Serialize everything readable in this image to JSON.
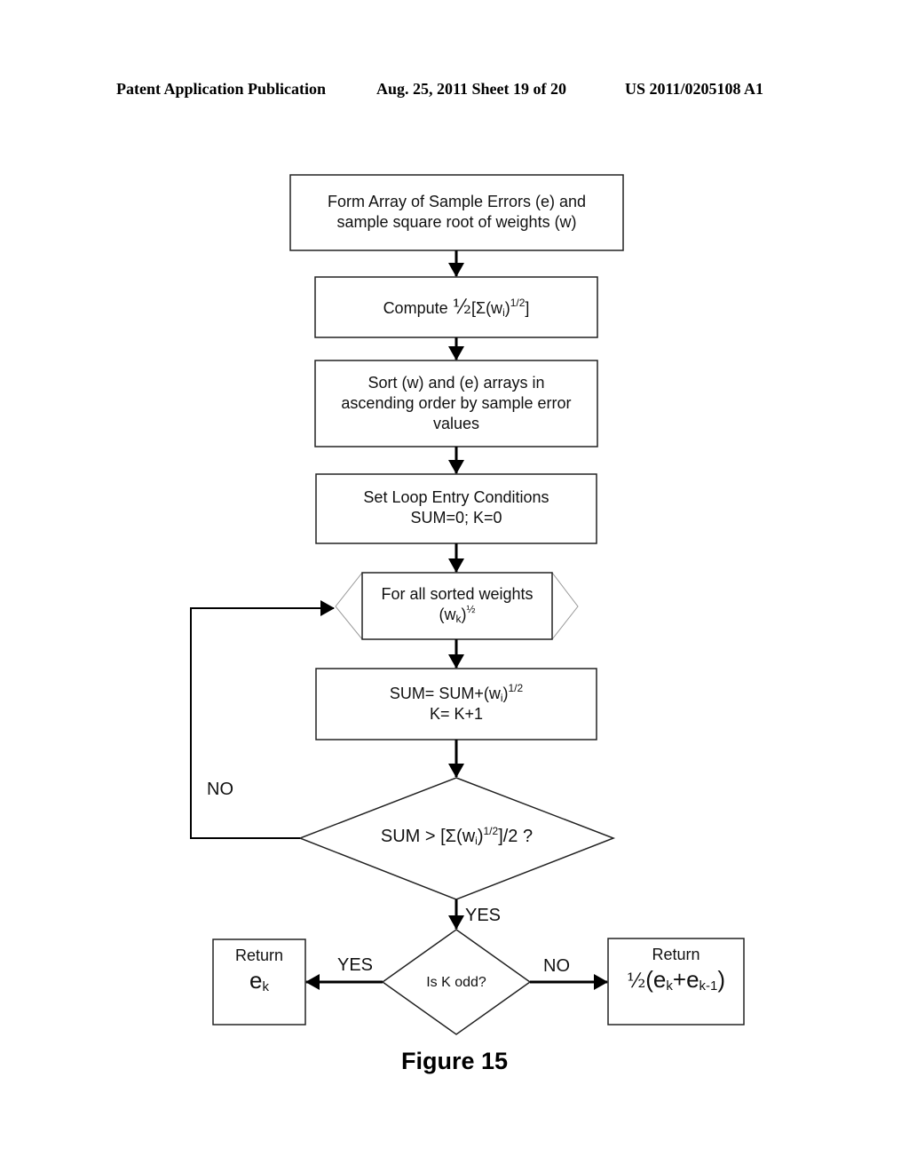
{
  "header": {
    "left": "Patent Application Publication",
    "middle": "Aug. 25, 2011  Sheet 19 of 20",
    "right": "US 2011/0205108 A1"
  },
  "flowchart": {
    "nodes": {
      "form_array": {
        "line1": "Form Array of Sample Errors (e) and",
        "line2": "sample square root of weights (w)"
      },
      "compute": {
        "prefix": "Compute ",
        "half": "½",
        "open": "[Σ(w",
        "sub": "i",
        "close": ")",
        "sup": "1/2",
        "end": "]"
      },
      "sort": {
        "line1": "Sort (w) and (e) arrays in",
        "line2": "ascending order by sample error",
        "line3": "values"
      },
      "loop_entry": {
        "line1": "Set Loop Entry Conditions",
        "line2": "SUM=0; K=0"
      },
      "for_all": {
        "line1": "For all sorted weights",
        "base": "(w",
        "sub": "k",
        "close": ")",
        "sup": "½"
      },
      "sum_update": {
        "l1_base": "SUM= SUM+(w",
        "l1_sub": "i",
        "l1_close": ")",
        "l1_sup": "1/2",
        "line2": "K= K+1"
      },
      "decision_sum": {
        "base": "SUM > [Σ(w",
        "sub": "i",
        "close": ")",
        "sup": "1/2",
        "end": "]/2 ?"
      },
      "decision_odd": {
        "text": "Is K odd?"
      },
      "return_ek": {
        "title": "Return",
        "base": "e",
        "sub": "k"
      },
      "return_avg": {
        "title": "Return",
        "half": "½",
        "open": "(e",
        "sub1": "k",
        "plus": "+e",
        "sub2": "k-1",
        "close": ")"
      }
    },
    "edge_labels": {
      "loop_no": "NO",
      "sum_yes": "YES",
      "odd_yes": "YES",
      "odd_no": "NO"
    }
  },
  "figure_caption": "Figure 15"
}
